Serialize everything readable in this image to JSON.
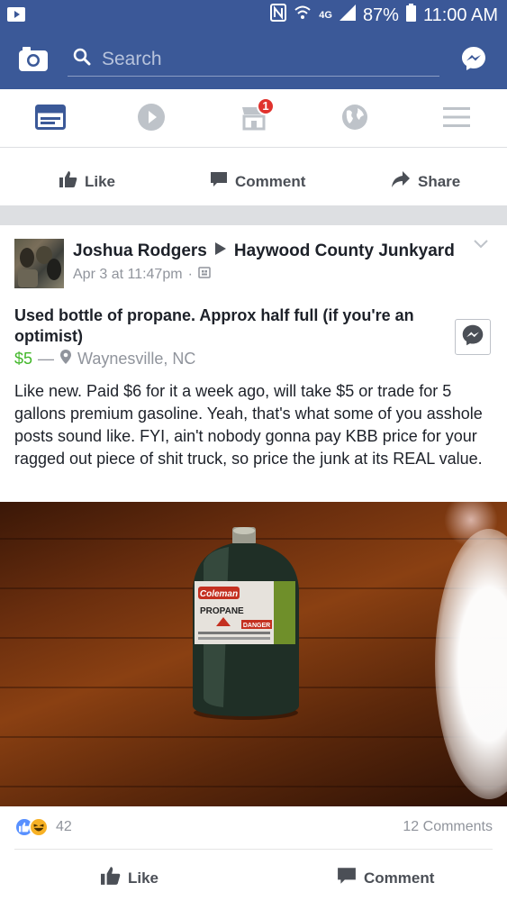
{
  "status_bar": {
    "battery": "87%",
    "time": "11:00 AM",
    "network": "4G"
  },
  "header": {
    "search_placeholder": "Search"
  },
  "tabs": {
    "marketplace_badge": "1"
  },
  "prev_post_actions": {
    "like": "Like",
    "comment": "Comment",
    "share": "Share"
  },
  "post": {
    "author": "Joshua Rodgers",
    "group": "Haywood County Junkyard",
    "timestamp": "Apr 3 at 11:47pm",
    "separator": "·",
    "title": "Used bottle of propane. Approx half full (if you're an optimist)",
    "price": "$5",
    "dash": "—",
    "location": "Waynesville, NC",
    "body": "Like new. Paid $6 for it a week ago, will take $5 or trade for 5 gallons premium gasoline. Yeah, that's what some of you asshole posts sound like. FYI, ain't nobody gonna pay KBB price for your ragged out piece of shit truck, so price the junk at its REAL value.",
    "bottle_brand": "Coleman",
    "bottle_label": "PROPANE",
    "bottle_warning": "DANGER",
    "reaction_count": "42",
    "comments_count": "12 Comments",
    "like_label": "Like",
    "comment_label": "Comment"
  },
  "colors": {
    "brand_blue": "#3b5998",
    "price_green": "#42b72a",
    "badge_red": "#e0322d"
  }
}
